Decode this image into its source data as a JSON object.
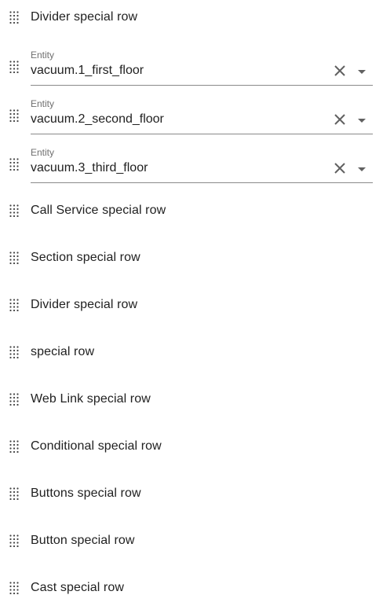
{
  "rows": [
    {
      "type": "special",
      "label": "Divider special row"
    },
    {
      "type": "entity",
      "caption": "Entity",
      "value": "vacuum.1_first_floor"
    },
    {
      "type": "entity",
      "caption": "Entity",
      "value": "vacuum.2_second_floor"
    },
    {
      "type": "entity",
      "caption": "Entity",
      "value": "vacuum.3_third_floor"
    },
    {
      "type": "special",
      "label": "Call Service special row"
    },
    {
      "type": "special",
      "label": "Section special row"
    },
    {
      "type": "special",
      "label": "Divider special row"
    },
    {
      "type": "special",
      "label": "special row"
    },
    {
      "type": "special",
      "label": "Web Link special row"
    },
    {
      "type": "special",
      "label": "Conditional special row"
    },
    {
      "type": "special",
      "label": "Buttons special row"
    },
    {
      "type": "special",
      "label": "Button special row"
    },
    {
      "type": "special",
      "label": "Cast special row"
    }
  ],
  "icons": {
    "handle": "drag-handle-icon",
    "clear": "close-icon",
    "dropdown": "menu-down-icon"
  },
  "colors": {
    "text": "#212121",
    "caption": "#6f6f6f",
    "underline": "#8a8a8a",
    "icon": "#616161"
  }
}
